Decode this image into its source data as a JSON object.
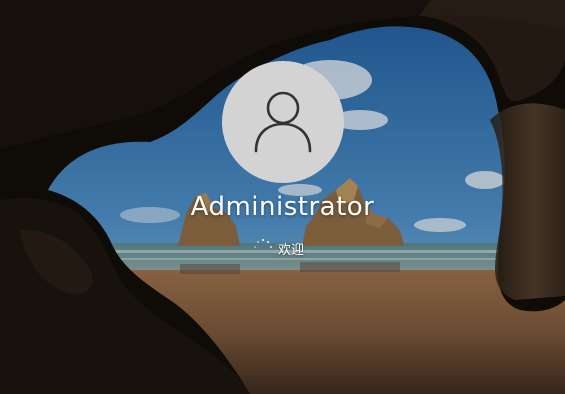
{
  "login": {
    "username": "Administrator",
    "status_text": "欢迎"
  },
  "icons": {
    "avatar": "user-avatar-icon",
    "spinner": "loading-spinner-icon"
  },
  "colors": {
    "avatar_background": "#d3d3d3",
    "avatar_glyph": "#333333",
    "text": "#ffffff"
  }
}
